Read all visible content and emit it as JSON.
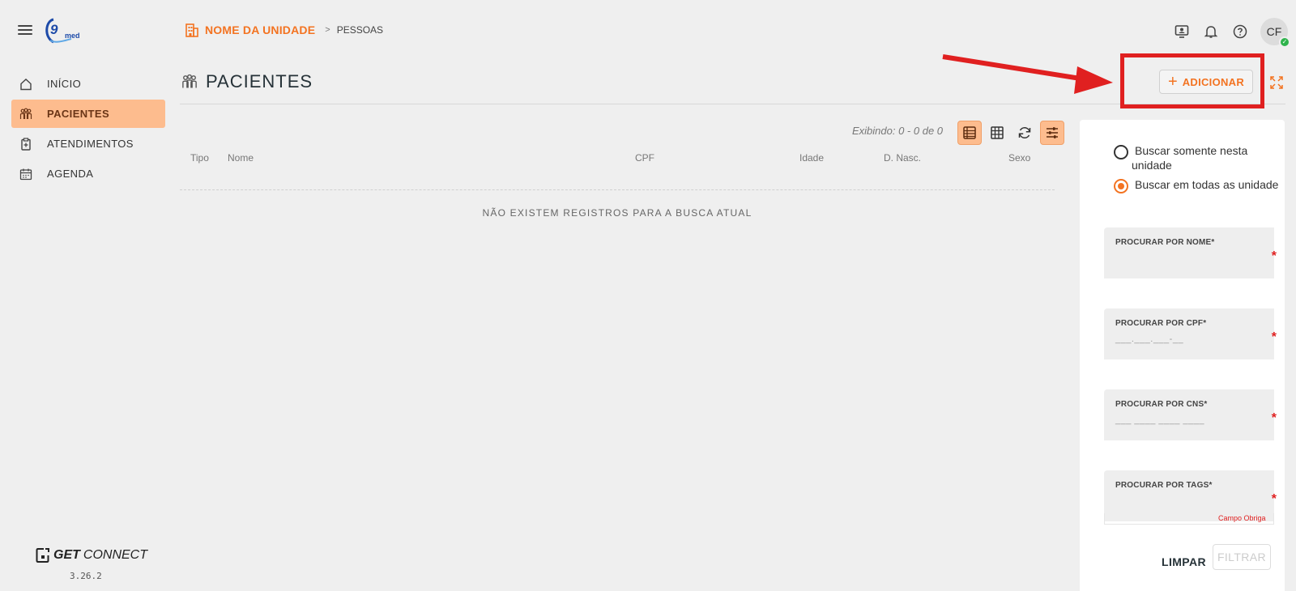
{
  "app": {
    "logo_text": "9",
    "logo_small": "med"
  },
  "breadcrumb": {
    "unit": "NOME DA UNIDADE",
    "separator": ">",
    "page": "PESSOAS"
  },
  "user": {
    "initials": "CF",
    "status_mark": "✓"
  },
  "sidebar": {
    "items": [
      {
        "label": "INÍCIO",
        "icon": "home-icon"
      },
      {
        "label": "PACIENTES",
        "icon": "people-icon",
        "active": true
      },
      {
        "label": "ATENDIMENTOS",
        "icon": "clipboard-icon"
      },
      {
        "label": "AGENDA",
        "icon": "calendar-icon"
      }
    ]
  },
  "brand": {
    "get": "GET",
    "connect": "CONNECT",
    "version": "3.26.2"
  },
  "page": {
    "title": "PACIENTES",
    "add_label": "ADICIONAR",
    "add_symbol": "+"
  },
  "table": {
    "showing": "Exibindo: 0 - 0 de 0",
    "columns": [
      "Tipo",
      "Nome",
      "CPF",
      "Idade",
      "D. Nasc.",
      "Sexo"
    ],
    "empty_message": "NÃO EXISTEM REGISTROS PARA A BUSCA ATUAL"
  },
  "filters": {
    "radio_unit_line1": "Buscar somente nesta",
    "radio_unit_line2": "unidade",
    "radio_all": "Buscar em todas as unidade",
    "fields": [
      {
        "label": "PROCURAR POR NOME*",
        "value": ""
      },
      {
        "label": "PROCURAR POR CPF*",
        "value": "___.___.___-__"
      },
      {
        "label": "PROCURAR POR CNS*",
        "value": "___ ____ ____ ____"
      },
      {
        "label": "PROCURAR POR TAGS*",
        "value": ""
      }
    ],
    "required_mark": "*",
    "hint": "Campo Obriga",
    "clear_label": "LIMPAR",
    "filter_label": "FILTRAR"
  },
  "colors": {
    "accent": "#f37321",
    "active_bg": "#fdbc8e",
    "annotation": "#e02020"
  }
}
